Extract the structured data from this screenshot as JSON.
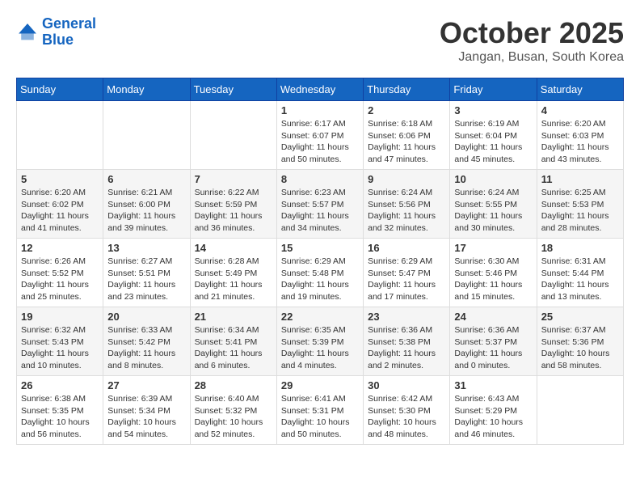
{
  "header": {
    "logo": {
      "line1": "General",
      "line2": "Blue"
    },
    "month": "October 2025",
    "location": "Jangan, Busan, South Korea"
  },
  "weekdays": [
    "Sunday",
    "Monday",
    "Tuesday",
    "Wednesday",
    "Thursday",
    "Friday",
    "Saturday"
  ],
  "weeks": [
    [
      {
        "day": "",
        "sunrise": "",
        "sunset": "",
        "daylight": ""
      },
      {
        "day": "",
        "sunrise": "",
        "sunset": "",
        "daylight": ""
      },
      {
        "day": "",
        "sunrise": "",
        "sunset": "",
        "daylight": ""
      },
      {
        "day": "1",
        "sunrise": "Sunrise: 6:17 AM",
        "sunset": "Sunset: 6:07 PM",
        "daylight": "Daylight: 11 hours and 50 minutes."
      },
      {
        "day": "2",
        "sunrise": "Sunrise: 6:18 AM",
        "sunset": "Sunset: 6:06 PM",
        "daylight": "Daylight: 11 hours and 47 minutes."
      },
      {
        "day": "3",
        "sunrise": "Sunrise: 6:19 AM",
        "sunset": "Sunset: 6:04 PM",
        "daylight": "Daylight: 11 hours and 45 minutes."
      },
      {
        "day": "4",
        "sunrise": "Sunrise: 6:20 AM",
        "sunset": "Sunset: 6:03 PM",
        "daylight": "Daylight: 11 hours and 43 minutes."
      }
    ],
    [
      {
        "day": "5",
        "sunrise": "Sunrise: 6:20 AM",
        "sunset": "Sunset: 6:02 PM",
        "daylight": "Daylight: 11 hours and 41 minutes."
      },
      {
        "day": "6",
        "sunrise": "Sunrise: 6:21 AM",
        "sunset": "Sunset: 6:00 PM",
        "daylight": "Daylight: 11 hours and 39 minutes."
      },
      {
        "day": "7",
        "sunrise": "Sunrise: 6:22 AM",
        "sunset": "Sunset: 5:59 PM",
        "daylight": "Daylight: 11 hours and 36 minutes."
      },
      {
        "day": "8",
        "sunrise": "Sunrise: 6:23 AM",
        "sunset": "Sunset: 5:57 PM",
        "daylight": "Daylight: 11 hours and 34 minutes."
      },
      {
        "day": "9",
        "sunrise": "Sunrise: 6:24 AM",
        "sunset": "Sunset: 5:56 PM",
        "daylight": "Daylight: 11 hours and 32 minutes."
      },
      {
        "day": "10",
        "sunrise": "Sunrise: 6:24 AM",
        "sunset": "Sunset: 5:55 PM",
        "daylight": "Daylight: 11 hours and 30 minutes."
      },
      {
        "day": "11",
        "sunrise": "Sunrise: 6:25 AM",
        "sunset": "Sunset: 5:53 PM",
        "daylight": "Daylight: 11 hours and 28 minutes."
      }
    ],
    [
      {
        "day": "12",
        "sunrise": "Sunrise: 6:26 AM",
        "sunset": "Sunset: 5:52 PM",
        "daylight": "Daylight: 11 hours and 25 minutes."
      },
      {
        "day": "13",
        "sunrise": "Sunrise: 6:27 AM",
        "sunset": "Sunset: 5:51 PM",
        "daylight": "Daylight: 11 hours and 23 minutes."
      },
      {
        "day": "14",
        "sunrise": "Sunrise: 6:28 AM",
        "sunset": "Sunset: 5:49 PM",
        "daylight": "Daylight: 11 hours and 21 minutes."
      },
      {
        "day": "15",
        "sunrise": "Sunrise: 6:29 AM",
        "sunset": "Sunset: 5:48 PM",
        "daylight": "Daylight: 11 hours and 19 minutes."
      },
      {
        "day": "16",
        "sunrise": "Sunrise: 6:29 AM",
        "sunset": "Sunset: 5:47 PM",
        "daylight": "Daylight: 11 hours and 17 minutes."
      },
      {
        "day": "17",
        "sunrise": "Sunrise: 6:30 AM",
        "sunset": "Sunset: 5:46 PM",
        "daylight": "Daylight: 11 hours and 15 minutes."
      },
      {
        "day": "18",
        "sunrise": "Sunrise: 6:31 AM",
        "sunset": "Sunset: 5:44 PM",
        "daylight": "Daylight: 11 hours and 13 minutes."
      }
    ],
    [
      {
        "day": "19",
        "sunrise": "Sunrise: 6:32 AM",
        "sunset": "Sunset: 5:43 PM",
        "daylight": "Daylight: 11 hours and 10 minutes."
      },
      {
        "day": "20",
        "sunrise": "Sunrise: 6:33 AM",
        "sunset": "Sunset: 5:42 PM",
        "daylight": "Daylight: 11 hours and 8 minutes."
      },
      {
        "day": "21",
        "sunrise": "Sunrise: 6:34 AM",
        "sunset": "Sunset: 5:41 PM",
        "daylight": "Daylight: 11 hours and 6 minutes."
      },
      {
        "day": "22",
        "sunrise": "Sunrise: 6:35 AM",
        "sunset": "Sunset: 5:39 PM",
        "daylight": "Daylight: 11 hours and 4 minutes."
      },
      {
        "day": "23",
        "sunrise": "Sunrise: 6:36 AM",
        "sunset": "Sunset: 5:38 PM",
        "daylight": "Daylight: 11 hours and 2 minutes."
      },
      {
        "day": "24",
        "sunrise": "Sunrise: 6:36 AM",
        "sunset": "Sunset: 5:37 PM",
        "daylight": "Daylight: 11 hours and 0 minutes."
      },
      {
        "day": "25",
        "sunrise": "Sunrise: 6:37 AM",
        "sunset": "Sunset: 5:36 PM",
        "daylight": "Daylight: 10 hours and 58 minutes."
      }
    ],
    [
      {
        "day": "26",
        "sunrise": "Sunrise: 6:38 AM",
        "sunset": "Sunset: 5:35 PM",
        "daylight": "Daylight: 10 hours and 56 minutes."
      },
      {
        "day": "27",
        "sunrise": "Sunrise: 6:39 AM",
        "sunset": "Sunset: 5:34 PM",
        "daylight": "Daylight: 10 hours and 54 minutes."
      },
      {
        "day": "28",
        "sunrise": "Sunrise: 6:40 AM",
        "sunset": "Sunset: 5:32 PM",
        "daylight": "Daylight: 10 hours and 52 minutes."
      },
      {
        "day": "29",
        "sunrise": "Sunrise: 6:41 AM",
        "sunset": "Sunset: 5:31 PM",
        "daylight": "Daylight: 10 hours and 50 minutes."
      },
      {
        "day": "30",
        "sunrise": "Sunrise: 6:42 AM",
        "sunset": "Sunset: 5:30 PM",
        "daylight": "Daylight: 10 hours and 48 minutes."
      },
      {
        "day": "31",
        "sunrise": "Sunrise: 6:43 AM",
        "sunset": "Sunset: 5:29 PM",
        "daylight": "Daylight: 10 hours and 46 minutes."
      },
      {
        "day": "",
        "sunrise": "",
        "sunset": "",
        "daylight": ""
      }
    ]
  ]
}
